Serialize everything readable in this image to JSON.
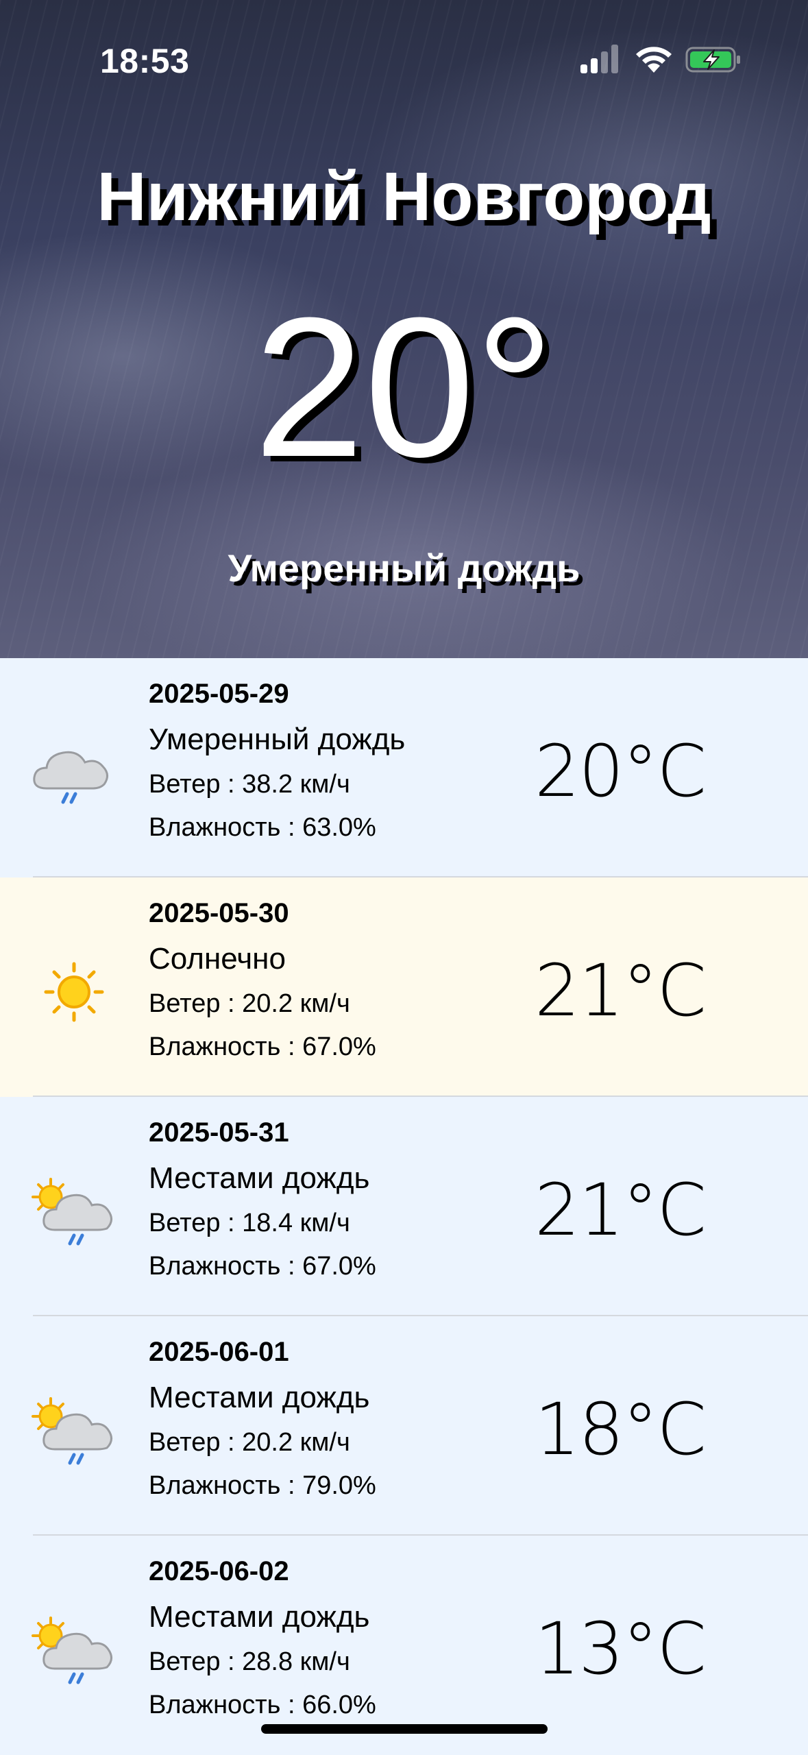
{
  "status_bar": {
    "time": "18:53",
    "signal_icon": "cellular-signal-icon",
    "wifi_icon": "wifi-icon",
    "battery_icon": "battery-charging-icon",
    "battery_color": "#34c759"
  },
  "current": {
    "city": "Нижний Новгород",
    "temperature": "20°",
    "description": "Умеренный дождь"
  },
  "forecast": [
    {
      "date": "2025-05-29",
      "condition": "Умеренный дождь",
      "wind": "Ветер : 38.2 км/ч",
      "humidity": "Влажность : 63.0%",
      "temp": "20°C",
      "icon": "rain-cloud-icon",
      "bg": "#ecf4fe"
    },
    {
      "date": "2025-05-30",
      "condition": "Солнечно",
      "wind": "Ветер : 20.2 км/ч",
      "humidity": "Влажность : 67.0%",
      "temp": "21°C",
      "icon": "sun-icon",
      "bg": "#fefaec"
    },
    {
      "date": "2025-05-31",
      "condition": "Местами дождь",
      "wind": "Ветер : 18.4 км/ч",
      "humidity": "Влажность : 67.0%",
      "temp": "21°C",
      "icon": "sun-rain-cloud-icon",
      "bg": "#ecf4fe"
    },
    {
      "date": "2025-06-01",
      "condition": "Местами дождь",
      "wind": "Ветер : 20.2 км/ч",
      "humidity": "Влажность : 79.0%",
      "temp": "18°C",
      "icon": "sun-rain-cloud-icon",
      "bg": "#ecf4fe"
    },
    {
      "date": "2025-06-02",
      "condition": "Местами дождь",
      "wind": "Ветер : 28.8 км/ч",
      "humidity": "Влажность : 66.0%",
      "temp": "13°C",
      "icon": "sun-rain-cloud-icon",
      "bg": "#ecf4fe"
    }
  ]
}
